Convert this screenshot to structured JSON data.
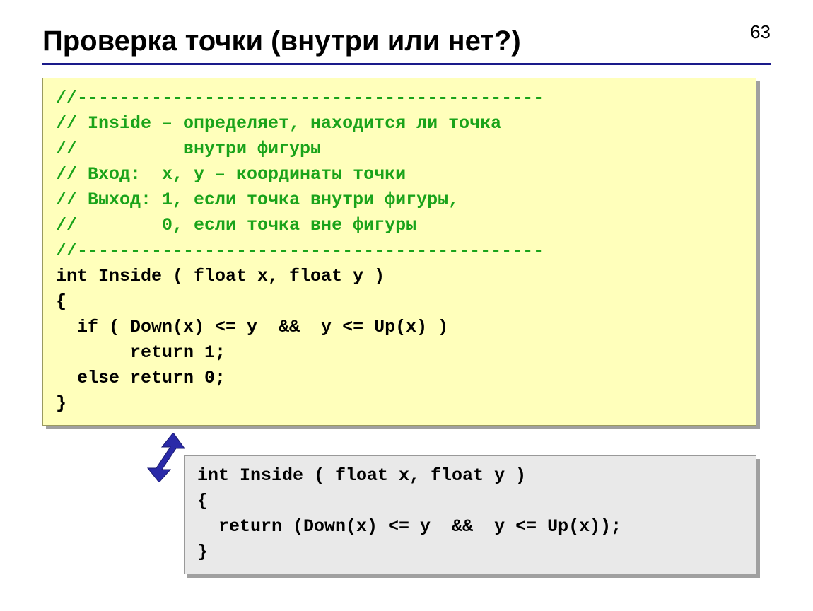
{
  "page_number": "63",
  "title": "Проверка точки (внутри или нет?)",
  "code_block_1": {
    "comment_lines": "//--------------------------------------------\n// Inside – определяет, находится ли точка\n//          внутри фигуры\n// Вход:  x, y – координаты точки\n// Выход: 1, если точка внутри фигуры,\n//        0, если точка вне фигуры\n//--------------------------------------------",
    "code_lines": "int Inside ( float x, float y )\n{\n  if ( Down(x) <= y  &&  y <= Up(x) )\n       return 1;\n  else return 0;\n}"
  },
  "code_block_2": {
    "code_lines": "int Inside ( float x, float y )\n{\n  return (Down(x) <= y  &&  y <= Up(x));\n}"
  },
  "arrow_color": "#2a2aa8"
}
